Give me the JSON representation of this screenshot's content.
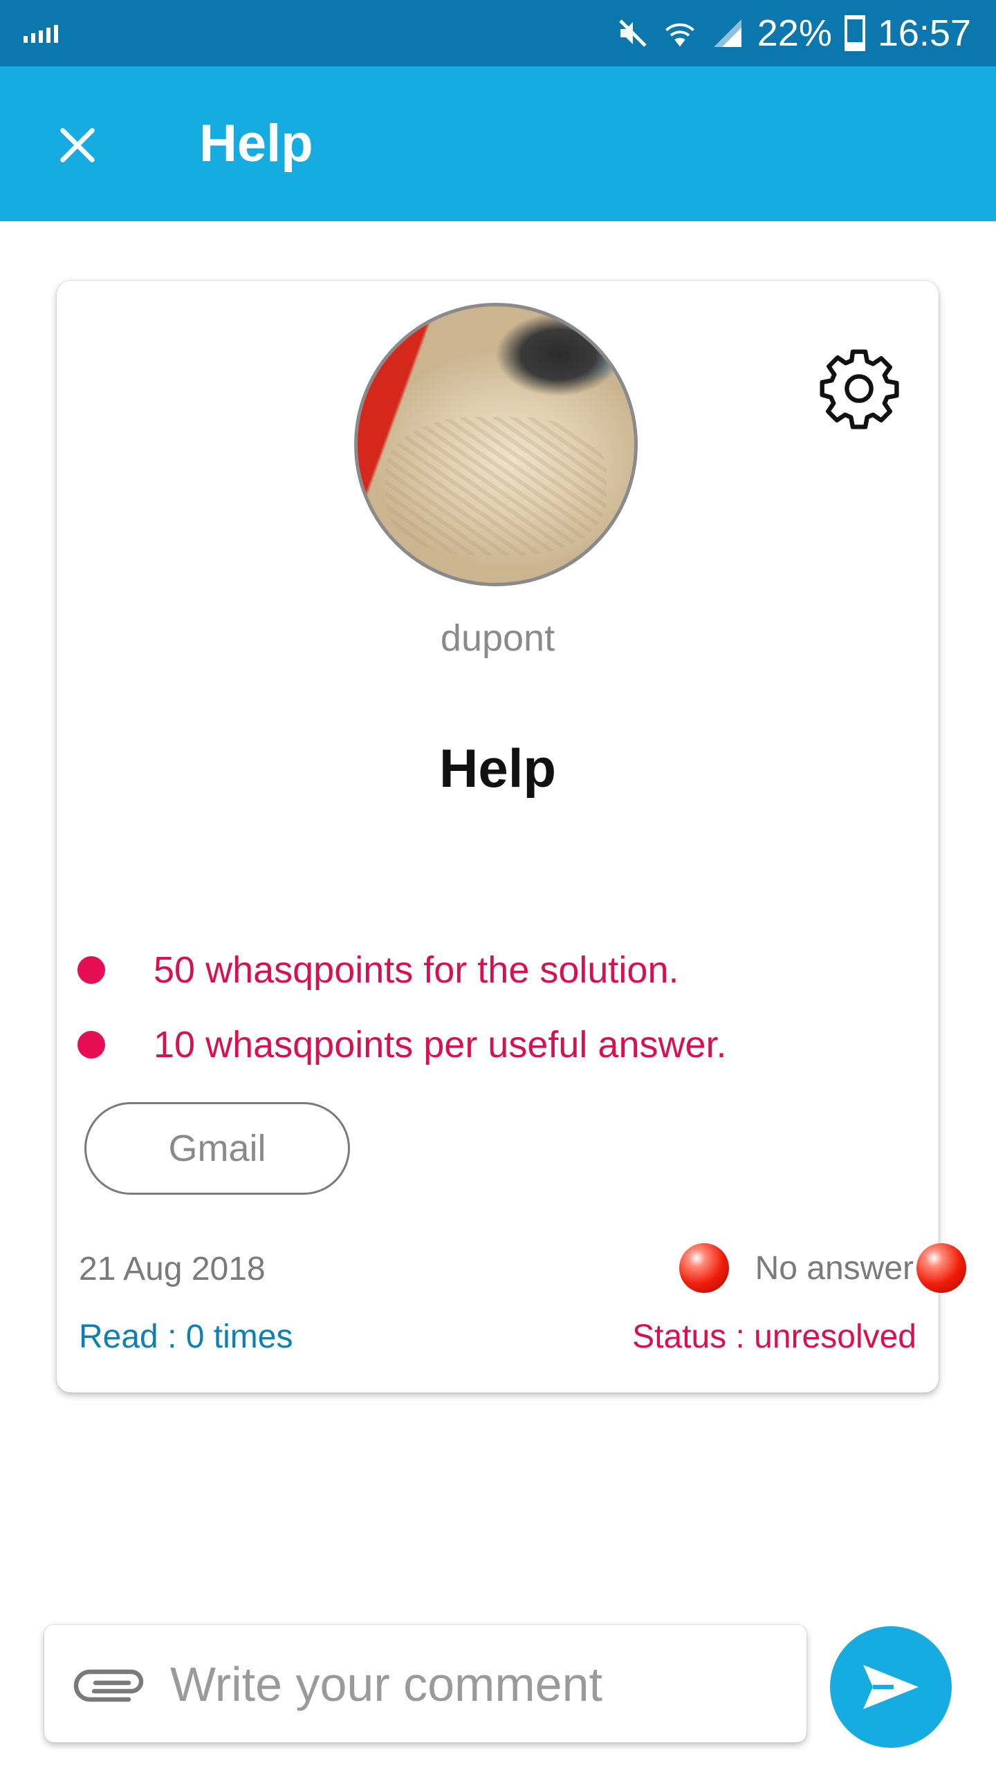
{
  "status_bar": {
    "battery": "22%",
    "time": "16:57"
  },
  "app_bar": {
    "title": "Help",
    "close_icon": "close-icon"
  },
  "post": {
    "username": "dupont",
    "title": "Help",
    "rewards": [
      "50 whasqpoints for the solution.",
      "10 whasqpoints per useful answer."
    ],
    "tag": "Gmail",
    "date": "21 Aug 2018",
    "read_count": "Read : 0 times",
    "answer_status": "No answer",
    "status": "Status : unresolved",
    "settings_icon": "gear-icon"
  },
  "comment": {
    "placeholder": "Write your comment",
    "attach_icon": "paperclip-icon",
    "send_icon": "send-icon"
  },
  "colors": {
    "status_bar": "#0b77ad",
    "app_bar": "#16ace1",
    "accent_red": "#d8104f",
    "link_blue": "#0b7fb6"
  }
}
